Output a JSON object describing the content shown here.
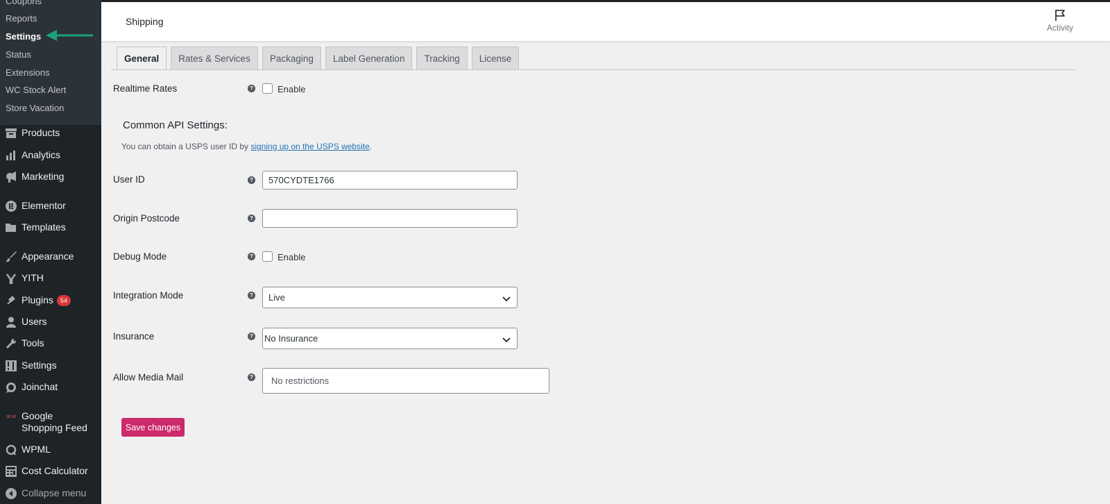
{
  "submenu": {
    "items": [
      {
        "label": "Coupons",
        "current": false
      },
      {
        "label": "Reports",
        "current": false
      },
      {
        "label": "Settings",
        "current": true
      },
      {
        "label": "Status",
        "current": false
      },
      {
        "label": "Extensions",
        "current": false
      },
      {
        "label": "WC Stock Alert",
        "current": false
      },
      {
        "label": "Store Vacation",
        "current": false
      }
    ]
  },
  "menu": {
    "items": [
      {
        "label": "Products",
        "icon": "archive-icon"
      },
      {
        "label": "Analytics",
        "icon": "bar-chart-icon"
      },
      {
        "label": "Marketing",
        "icon": "megaphone-icon"
      },
      {
        "label": "Elementor",
        "icon": "elementor-icon"
      },
      {
        "label": "Templates",
        "icon": "folder-icon"
      },
      {
        "label": "Appearance",
        "icon": "paintbrush-icon"
      },
      {
        "label": "YITH",
        "icon": "yith-icon"
      },
      {
        "label": "Plugins",
        "icon": "plug-icon",
        "badge": "54"
      },
      {
        "label": "Users",
        "icon": "user-icon"
      },
      {
        "label": "Tools",
        "icon": "wrench-icon"
      },
      {
        "label": "Settings",
        "icon": "settings-icon"
      },
      {
        "label": "Joinchat",
        "icon": "whatsapp-icon"
      },
      {
        "label": "Google Shopping Feed",
        "icon": "google-shopping-icon",
        "icon_text": "ol ot"
      },
      {
        "label": "WPML",
        "icon": "wpml-icon"
      },
      {
        "label": "Cost Calculator",
        "icon": "calculator-icon"
      },
      {
        "label": "Collapse menu",
        "icon": "collapse-icon"
      }
    ]
  },
  "header": {
    "title": "Shipping",
    "activity_label": "Activity"
  },
  "tabs": [
    {
      "label": "General",
      "active": true
    },
    {
      "label": "Rates & Services",
      "active": false
    },
    {
      "label": "Packaging",
      "active": false
    },
    {
      "label": "Label Generation",
      "active": false
    },
    {
      "label": "Tracking",
      "active": false
    },
    {
      "label": "License",
      "active": false
    }
  ],
  "form": {
    "realtime_rates": {
      "label": "Realtime Rates",
      "checkbox_label": "Enable",
      "checked": false
    },
    "section_title": "Common API Settings:",
    "description_prefix": "You can obtain a USPS user ID by ",
    "description_link": "signing up on the USPS website",
    "description_suffix": ".",
    "user_id": {
      "label": "User ID",
      "value": "570CYDTE1766"
    },
    "origin_postcode": {
      "label": "Origin Postcode",
      "value": ""
    },
    "debug_mode": {
      "label": "Debug Mode",
      "checkbox_label": "Enable",
      "checked": false
    },
    "integration_mode": {
      "label": "Integration Mode",
      "value": "Live"
    },
    "insurance": {
      "label": "Insurance",
      "value": "No Insurance"
    },
    "allow_media_mail": {
      "label": "Allow Media Mail",
      "placeholder": "No restrictions"
    },
    "help_glyph": "?",
    "save_label": "Save changes"
  },
  "colors": {
    "sidebar_bg": "#1d2327",
    "submenu_bg": "#2c3338",
    "accent_arrow": "#1aa37a",
    "save_button": "#cc2a6a",
    "badge": "#d63638",
    "link": "#2271b1"
  }
}
